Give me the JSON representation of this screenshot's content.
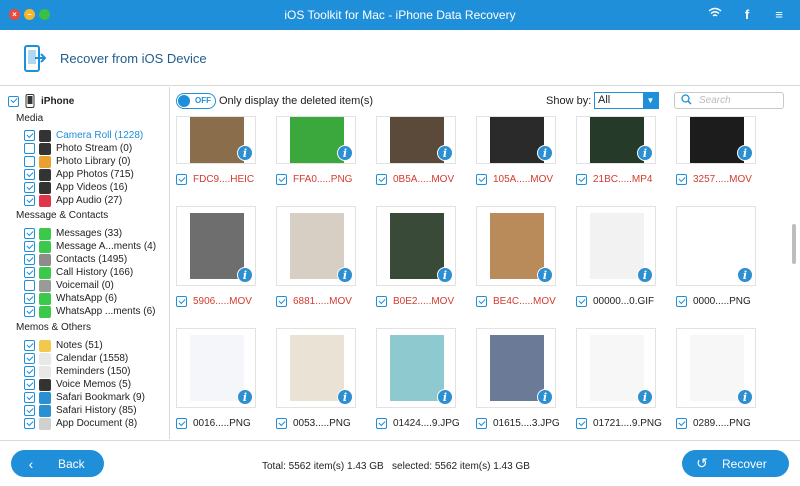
{
  "window": {
    "title": "iOS Toolkit for Mac - iPhone Data Recovery",
    "traffic_lights": [
      "×",
      "–",
      "‹›"
    ],
    "right_icons": [
      "wifi-icon",
      "facebook-icon",
      "menu-icon"
    ]
  },
  "header": {
    "title": "Recover from iOS Device"
  },
  "sidebar": {
    "device": "iPhone",
    "sections": [
      {
        "title": "Media",
        "items": [
          {
            "label": "Camera Roll (1228)",
            "checked": true,
            "active": true,
            "icon": "camera-icon",
            "color": "#333333"
          },
          {
            "label": "Photo Stream (0)",
            "checked": false,
            "icon": "photo-stream-icon",
            "color": "#333333"
          },
          {
            "label": "Photo Library (0)",
            "checked": false,
            "icon": "photo-library-icon",
            "color": "#e8a030"
          },
          {
            "label": "App Photos (715)",
            "checked": true,
            "icon": "app-photos-icon",
            "color": "#333333"
          },
          {
            "label": "App Videos (16)",
            "checked": true,
            "icon": "app-videos-icon",
            "color": "#333333"
          },
          {
            "label": "App Audio (27)",
            "checked": true,
            "icon": "app-audio-icon",
            "color": "#e0344a"
          }
        ]
      },
      {
        "title": "Message & Contacts",
        "items": [
          {
            "label": "Messages (33)",
            "checked": true,
            "icon": "messages-icon",
            "color": "#3cc84a"
          },
          {
            "label": "Message A...ments (4)",
            "checked": true,
            "icon": "message-attachments-icon",
            "color": "#3cc84a"
          },
          {
            "label": "Contacts (1495)",
            "checked": true,
            "icon": "contacts-icon",
            "color": "#8c8c8c"
          },
          {
            "label": "Call History (166)",
            "checked": true,
            "icon": "phone-icon",
            "color": "#3cc84a"
          },
          {
            "label": "Voicemail (0)",
            "checked": false,
            "icon": "voicemail-icon",
            "color": "#9a9a9a"
          },
          {
            "label": "WhatsApp (6)",
            "checked": true,
            "icon": "whatsapp-icon",
            "color": "#3cc84a"
          },
          {
            "label": "WhatsApp ...ments (6)",
            "checked": true,
            "icon": "whatsapp-attachments-icon",
            "color": "#3cc84a"
          }
        ]
      },
      {
        "title": "Memos & Others",
        "items": [
          {
            "label": "Notes (51)",
            "checked": true,
            "icon": "notes-icon",
            "color": "#f2c94c"
          },
          {
            "label": "Calendar (1558)",
            "checked": true,
            "icon": "calendar-icon",
            "color": "#e8e8e8"
          },
          {
            "label": "Reminders (150)",
            "checked": true,
            "icon": "reminders-icon",
            "color": "#e8e8e8"
          },
          {
            "label": "Voice Memos (5)",
            "checked": true,
            "icon": "voice-memos-icon",
            "color": "#333333"
          },
          {
            "label": "Safari Bookmark (9)",
            "checked": true,
            "icon": "safari-bookmark-icon",
            "color": "#2b8fd1"
          },
          {
            "label": "Safari History (85)",
            "checked": true,
            "icon": "safari-history-icon",
            "color": "#2b8fd1"
          },
          {
            "label": "App Document (8)",
            "checked": true,
            "icon": "app-document-icon",
            "color": "#d0d0d0"
          }
        ]
      }
    ]
  },
  "toolbar": {
    "toggle_state": "OFF",
    "only_deleted_label": "Only display the deleted item(s)",
    "show_by_label": "Show by:",
    "show_by_value": "All",
    "search_placeholder": "Search"
  },
  "grid": {
    "rows": [
      [
        {
          "name": "FDC9....HEIC",
          "deleted": true,
          "checked": true
        },
        {
          "name": "FFA0.....PNG",
          "deleted": true,
          "checked": true
        },
        {
          "name": "0B5A.....MOV",
          "deleted": true,
          "checked": true
        },
        {
          "name": "105A.....MOV",
          "deleted": true,
          "checked": true
        },
        {
          "name": "21BC.....MP4",
          "deleted": true,
          "checked": true
        },
        {
          "name": "3257.....MOV",
          "deleted": true,
          "checked": true
        }
      ],
      [
        {
          "name": "5906.....MOV",
          "deleted": true,
          "checked": true
        },
        {
          "name": "6881.....MOV",
          "deleted": true,
          "checked": true
        },
        {
          "name": "B0E2.....MOV",
          "deleted": true,
          "checked": true
        },
        {
          "name": "BE4C.....MOV",
          "deleted": true,
          "checked": true
        },
        {
          "name": "00000...0.GIF",
          "deleted": false,
          "checked": true
        },
        {
          "name": "0000.....PNG",
          "deleted": false,
          "checked": true
        }
      ],
      [
        {
          "name": "0016.....PNG",
          "deleted": false,
          "checked": true
        },
        {
          "name": "0053.....PNG",
          "deleted": false,
          "checked": true
        },
        {
          "name": "01424....9.JPG",
          "deleted": false,
          "checked": true
        },
        {
          "name": "01615....3.JPG",
          "deleted": false,
          "checked": true
        },
        {
          "name": "01721....9.PNG",
          "deleted": false,
          "checked": true
        },
        {
          "name": "0289.....PNG",
          "deleted": false,
          "checked": true
        }
      ]
    ]
  },
  "footer": {
    "back_label": "Back",
    "recover_label": "Recover",
    "status": "Total: 5562 item(s) 1.43 GB   selected: 5562 item(s) 1.43 GB"
  },
  "colors": {
    "accent": "#1e8fd8",
    "deleted_text": "#d23c2f",
    "title_bar": "#1e8fd8"
  }
}
